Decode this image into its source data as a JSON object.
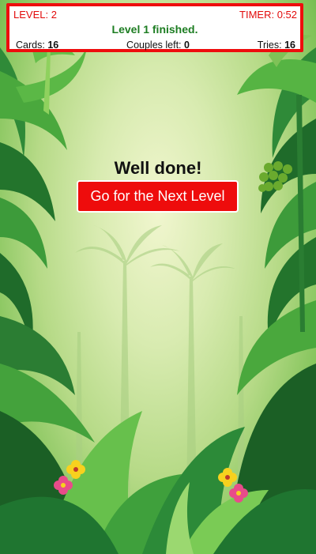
{
  "hud": {
    "level_label": "LEVEL: 2",
    "timer_label": "TIMER: 0:52",
    "message": "Level 1 finished.",
    "cards_label": "Cards:",
    "cards_value": "16",
    "couples_label": "Couples left:",
    "couples_value": "0",
    "tries_label": "Tries:",
    "tries_value": "16"
  },
  "overlay": {
    "title": "Well done!",
    "next_button_label": "Go for the Next Level"
  },
  "colors": {
    "accent_red": "#ee0d0d",
    "message_green": "#1d7d22",
    "jungle_dark": "#1f6b2a",
    "jungle_light": "#7fc257",
    "flower_pink": "#e84c8a",
    "flower_yellow": "#f7d11e"
  }
}
